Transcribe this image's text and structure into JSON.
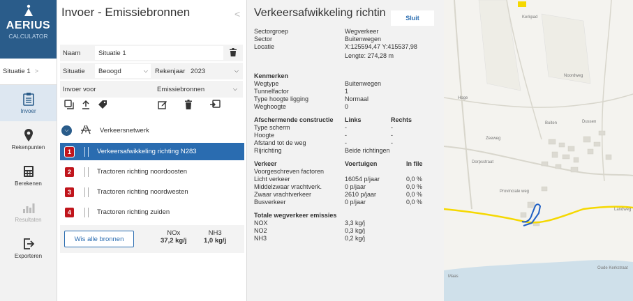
{
  "rail": {
    "brand": "AERIUS",
    "brand_sub": "CALCULATOR",
    "situation": "Situatie 1",
    "items": [
      {
        "label": "Invoer",
        "icon": "clipboard-icon"
      },
      {
        "label": "Rekenpunten",
        "icon": "map-pin-icon"
      },
      {
        "label": "Berekenen",
        "icon": "calculator-icon"
      },
      {
        "label": "Resultaten",
        "icon": "bar-chart-icon"
      },
      {
        "label": "Exporteren",
        "icon": "export-icon"
      }
    ]
  },
  "panel": {
    "title": "Invoer - Emissiebronnen",
    "name_label": "Naam",
    "name_value": "Situatie 1",
    "situation_label": "Situatie",
    "situation_value": "Beoogd",
    "year_label": "Rekenjaar",
    "year_value": "2023",
    "input_for_label": "Invoer voor",
    "input_for_value": "Emissiebronnen",
    "network_label": "Verkeersnetwerk",
    "sources": [
      {
        "num": "1",
        "label": "Verkeersafwikkeling richting N283",
        "selected": true
      },
      {
        "num": "2",
        "label": "Tractoren richting noordoosten",
        "selected": false
      },
      {
        "num": "3",
        "label": "Tractoren richting noordwesten",
        "selected": false
      },
      {
        "num": "4",
        "label": "Tractoren richting zuiden",
        "selected": false
      }
    ],
    "clear_button": "Wis alle bronnen",
    "nox_label": "NOx",
    "nox_value": "37,2 kg/j",
    "nh3_label": "NH3",
    "nh3_value": "1,0 kg/j"
  },
  "detail": {
    "title": "Verkeersafwikkeling richtin",
    "close": "Sluit",
    "sector_group_label": "Sectorgroep",
    "sector_group_value": "Wegverkeer",
    "sector_label": "Sector",
    "sector_value": "Buitenwegen",
    "location_label": "Locatie",
    "location_value": "X:125594,47 Y:415537,98",
    "length_value": "Lengte: 274,28 m",
    "features_header": "Kenmerken",
    "road_type_label": "Wegtype",
    "road_type_value": "Buitenwegen",
    "tunnel_label": "Tunnelfactor",
    "tunnel_value": "1",
    "height_type_label": "Type hoogte ligging",
    "height_type_value": "Normaal",
    "road_height_label": "Weghoogte",
    "road_height_value": "0",
    "barrier_header": "Afschermende constructie",
    "left_label": "Links",
    "right_label": "Rechts",
    "screen_type_label": "Type scherm",
    "height_label": "Hoogte",
    "distance_label": "Afstand tot de weg",
    "dash": "-",
    "direction_label": "Rijrichting",
    "direction_value": "Beide richtingen",
    "traffic_header": "Verkeer",
    "vehicles_label": "Voertuigen",
    "in_file_label": "In file",
    "prescribed_label": "Voorgeschreven factoren",
    "rows": [
      {
        "label": "Licht verkeer",
        "vehicles": "16054 p/jaar",
        "in_file": "0,0 %"
      },
      {
        "label": "Middelzwaar vrachtverk.",
        "vehicles": "0 p/jaar",
        "in_file": "0,0 %"
      },
      {
        "label": "Zwaar vrachtverkeer",
        "vehicles": "2610 p/jaar",
        "in_file": "0,0 %"
      },
      {
        "label": "Busverkeer",
        "vehicles": "0 p/jaar",
        "in_file": "0,0 %"
      }
    ],
    "emissions_header": "Totale wegverkeer emissies",
    "emissions": [
      {
        "label": "NOX",
        "value": "3,3 kg/j"
      },
      {
        "label": "NO2",
        "value": "0,3 kg/j"
      },
      {
        "label": "NH3",
        "value": "0,2 kg/j"
      }
    ]
  },
  "map": {
    "labels": [
      "Kerkpad",
      "Hoge",
      "Dussen",
      "Dorpsstraat",
      "Provinciale weg",
      "Landweg",
      "Oude Kerkstraat",
      "Maas",
      "Zeeweg",
      "Buiten",
      "Noordweg"
    ],
    "road_color": "#f5d800",
    "source_color": "#1f5fc4"
  }
}
